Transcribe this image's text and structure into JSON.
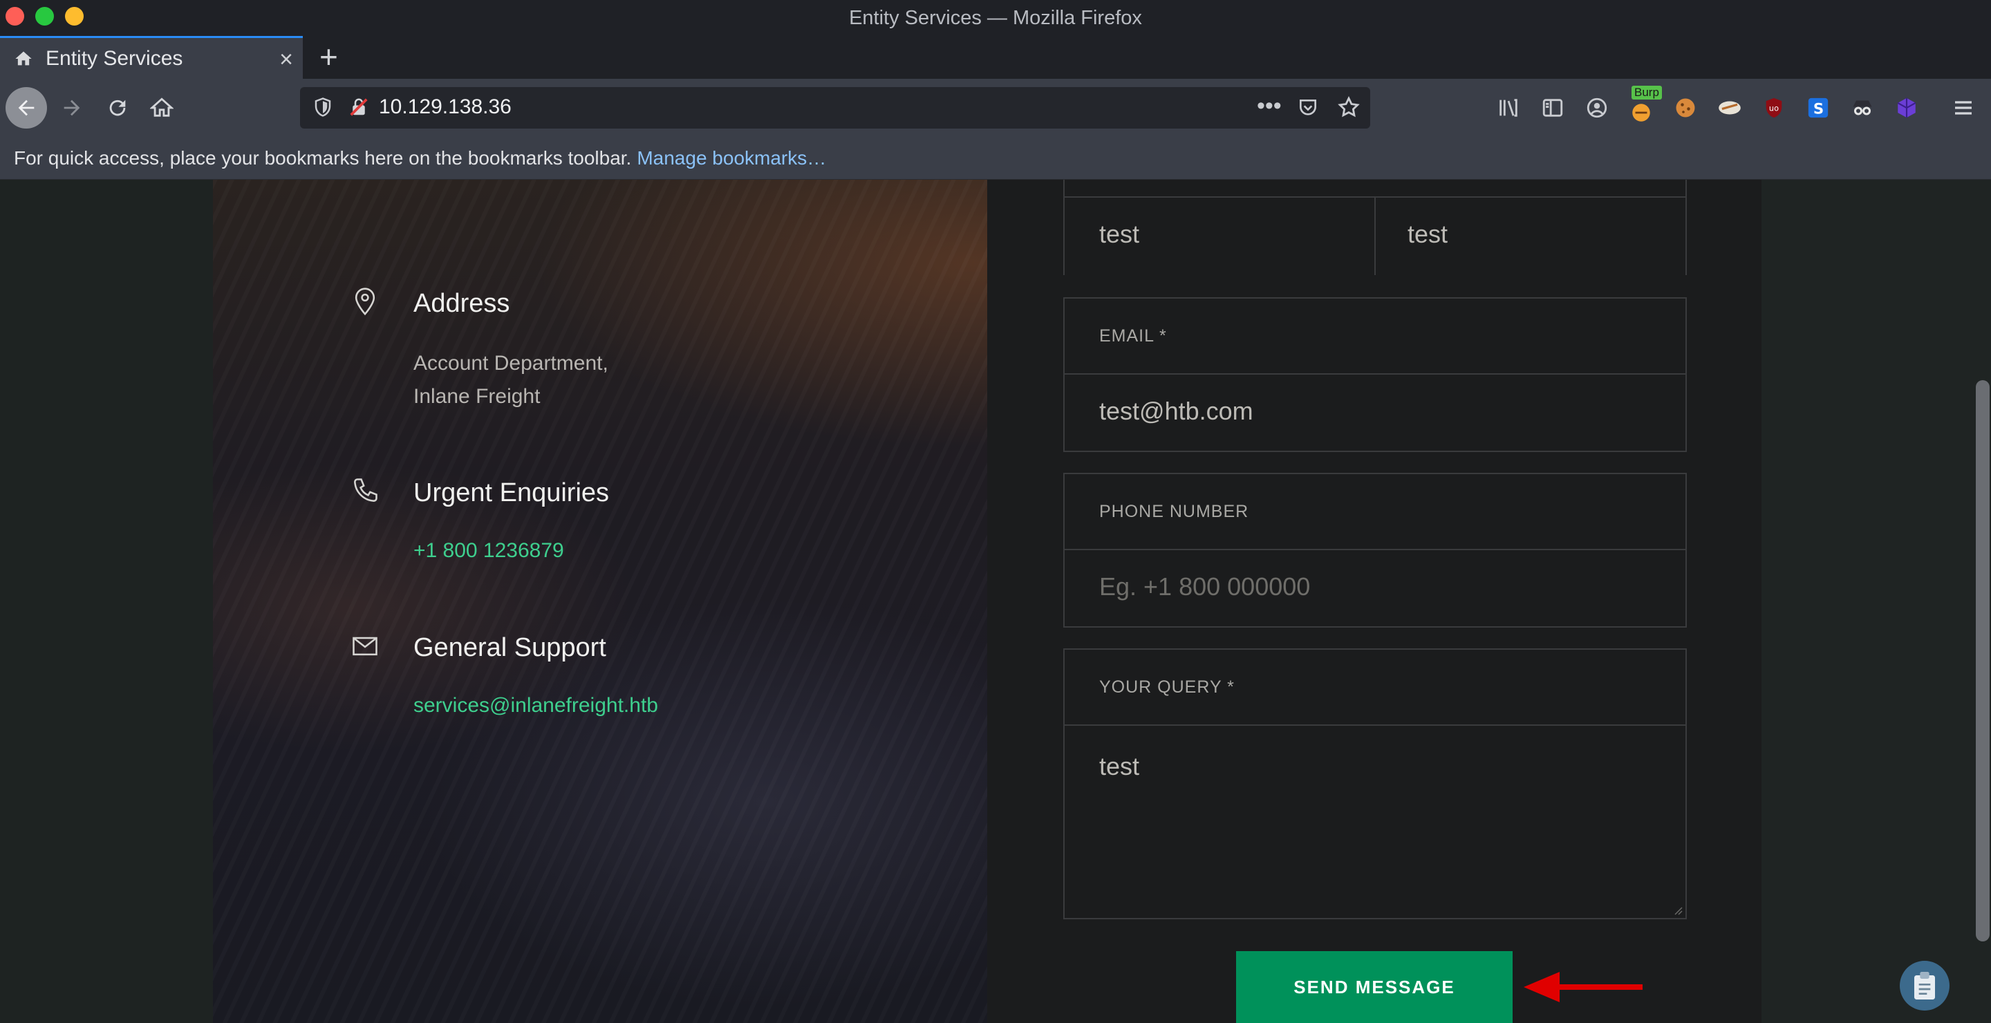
{
  "window": {
    "title": "Entity Services — Mozilla Firefox"
  },
  "tab": {
    "title": "Entity Services",
    "new_tab": "+"
  },
  "navbar": {
    "url": "10.129.138.36",
    "extension_badge": "Burp"
  },
  "bookmarks": {
    "message": "For quick access, place your bookmarks here on the bookmarks toolbar.",
    "manage_link": "Manage bookmarks…"
  },
  "contact": {
    "address_heading": "Address",
    "address_line1": "Account Department,",
    "address_line2": "Inlane Freight",
    "urgent_heading": "Urgent Enquiries",
    "phone": "+1 800 1236879",
    "support_heading": "General Support",
    "email": "services@inlanefreight.htb"
  },
  "form": {
    "first_name_value": "test",
    "last_name_value": "test",
    "email_label": "EMAIL *",
    "email_value": "test@htb.com",
    "phone_label": "PHONE NUMBER",
    "phone_placeholder": "Eg. +1 800 000000",
    "query_label": "YOUR QUERY *",
    "query_value": "test",
    "submit_label": "SEND MESSAGE"
  },
  "colors": {
    "accent_green": "#00915a",
    "link_green": "#3ecf8e",
    "annotation_arrow": "#e00000"
  }
}
